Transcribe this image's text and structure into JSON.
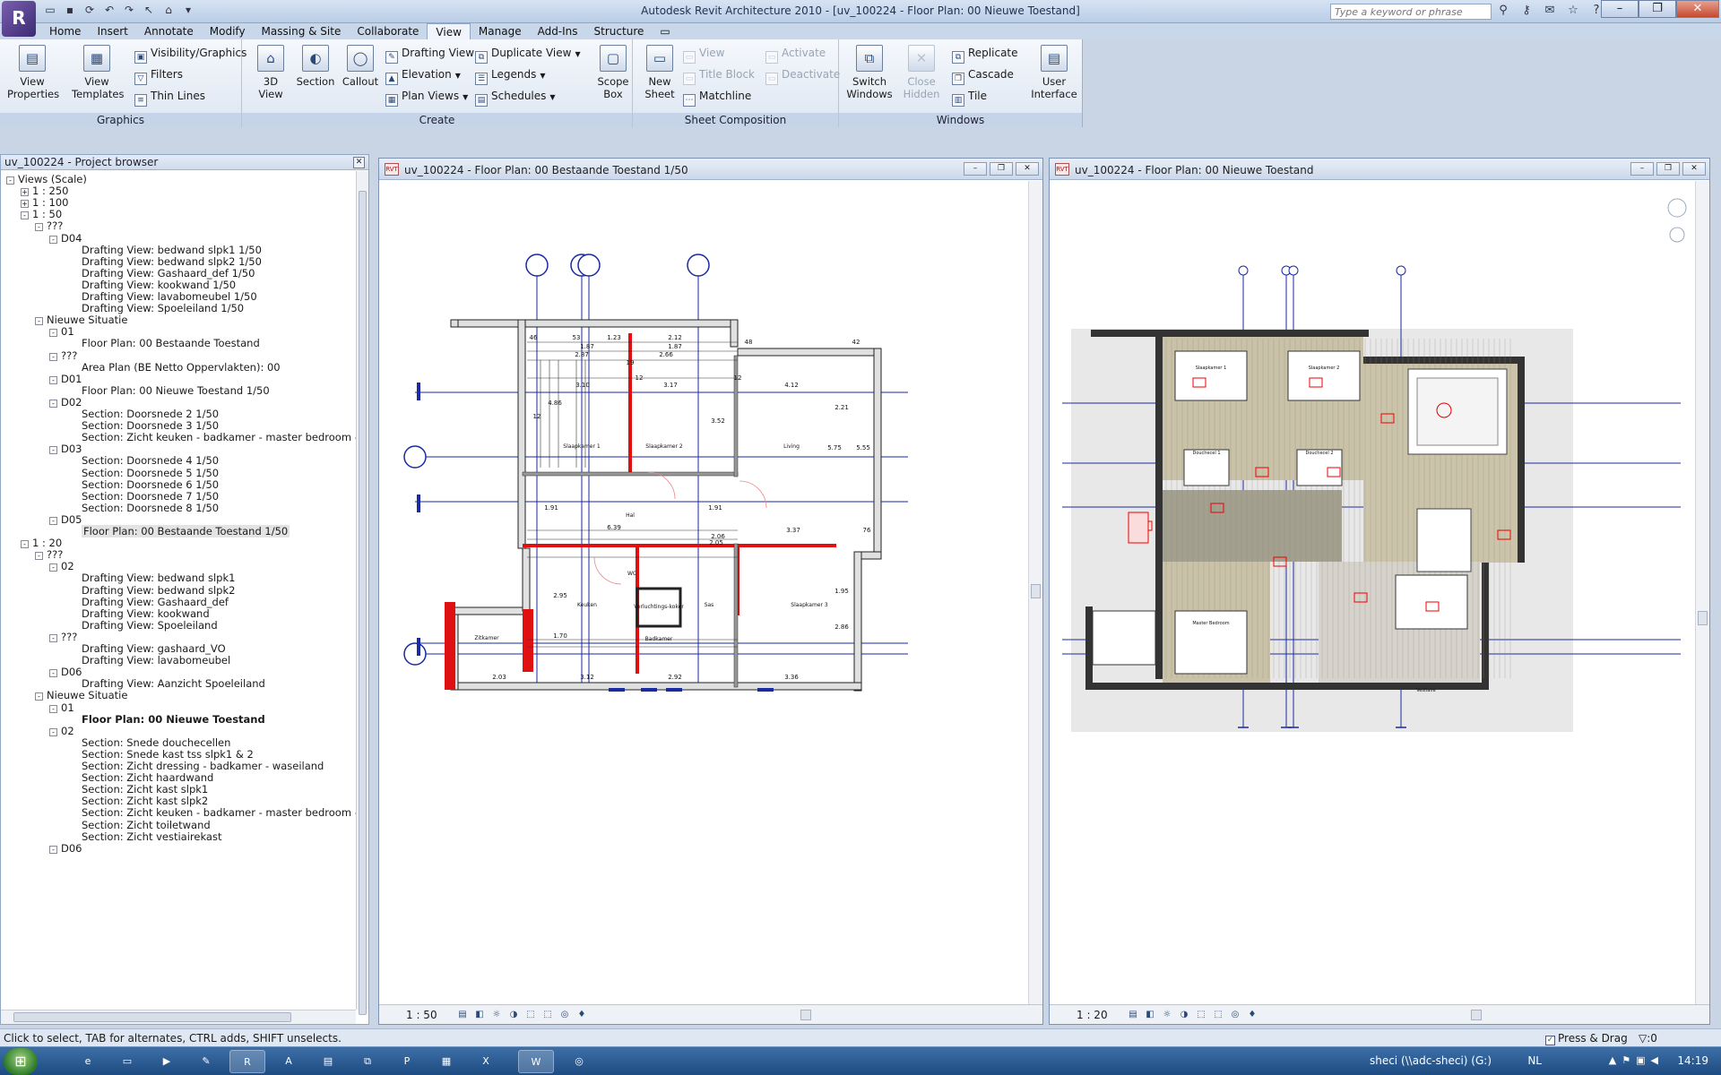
{
  "app": {
    "title": "Autodesk Revit Architecture 2010 - [uv_100224 - Floor Plan: 00 Nieuwe Toestand]",
    "logo_letter": "R",
    "search_placeholder": "Type a keyword or phrase"
  },
  "ribbon_tabs": [
    "Home",
    "Insert",
    "Annotate",
    "Modify",
    "Massing & Site",
    "Collaborate",
    "View",
    "Manage",
    "Add-Ins",
    "Structure"
  ],
  "active_tab": "View",
  "ribbon": {
    "graphics": {
      "label": "Graphics",
      "view_properties": "View\nProperties",
      "view_templates": "View\nTemplates",
      "visibility": "Visibility/Graphics",
      "filters": "Filters",
      "thin_lines": "Thin Lines"
    },
    "create": {
      "label": "Create",
      "view3d": "3D\nView",
      "section": "Section",
      "callout": "Callout",
      "drafting_view": "Drafting View",
      "elevation": "Elevation",
      "plan_views": "Plan Views",
      "duplicate_view": "Duplicate View",
      "legends": "Legends",
      "schedules": "Schedules",
      "scope_box": "Scope\nBox"
    },
    "sheet": {
      "label": "Sheet Composition",
      "new_sheet": "New\nSheet",
      "view": "View",
      "title_block": "Title Block",
      "matchline": "Matchline",
      "activate": "Activate",
      "deactivate": "Deactivate"
    },
    "windows": {
      "label": "Windows",
      "switch_windows": "Switch\nWindows",
      "close_hidden": "Close\nHidden",
      "replicate": "Replicate",
      "cascade": "Cascade",
      "tile": "Tile",
      "user_interface": "User\nInterface"
    }
  },
  "browser": {
    "title": "uv_100224 - Project browser",
    "items": [
      {
        "t": "Views (Scale)",
        "lvl": 0,
        "exp": "-"
      },
      {
        "t": "1 : 250",
        "lvl": 1,
        "exp": "+"
      },
      {
        "t": "1 : 100",
        "lvl": 1,
        "exp": "+"
      },
      {
        "t": "1 : 50",
        "lvl": 1,
        "exp": "-"
      },
      {
        "t": "???",
        "lvl": 2,
        "exp": "-"
      },
      {
        "t": "D04",
        "lvl": 3,
        "exp": "-"
      },
      {
        "t": "Drafting View: bedwand slpk1 1/50",
        "lvl": 4
      },
      {
        "t": "Drafting View: bedwand slpk2 1/50",
        "lvl": 4
      },
      {
        "t": "Drafting View: Gashaard_def 1/50",
        "lvl": 4
      },
      {
        "t": "Drafting View: kookwand 1/50",
        "lvl": 4
      },
      {
        "t": "Drafting View: lavabomeubel 1/50",
        "lvl": 4
      },
      {
        "t": "Drafting View: Spoeleiland 1/50",
        "lvl": 4
      },
      {
        "t": "Nieuwe Situatie",
        "lvl": 2,
        "exp": "-"
      },
      {
        "t": "01",
        "lvl": 3,
        "exp": "-"
      },
      {
        "t": "Floor Plan: 00 Bestaande Toestand",
        "lvl": 4
      },
      {
        "t": "???",
        "lvl": 3,
        "exp": "-"
      },
      {
        "t": "Area Plan (BE Netto Oppervlakten): 00",
        "lvl": 4
      },
      {
        "t": "D01",
        "lvl": 3,
        "exp": "-"
      },
      {
        "t": "Floor Plan: 00 Nieuwe Toestand 1/50",
        "lvl": 4
      },
      {
        "t": "D02",
        "lvl": 3,
        "exp": "-"
      },
      {
        "t": "Section: Doorsnede 2 1/50",
        "lvl": 4
      },
      {
        "t": "Section: Doorsnede 3 1/50",
        "lvl": 4
      },
      {
        "t": "Section: Zicht keuken - badkamer - master bedroom - di",
        "lvl": 4
      },
      {
        "t": "D03",
        "lvl": 3,
        "exp": "-"
      },
      {
        "t": "Section: Doorsnede 4 1/50",
        "lvl": 4
      },
      {
        "t": "Section: Doorsnede 5 1/50",
        "lvl": 4
      },
      {
        "t": "Section: Doorsnede 6 1/50",
        "lvl": 4
      },
      {
        "t": "Section: Doorsnede 7 1/50",
        "lvl": 4
      },
      {
        "t": "Section: Doorsnede 8 1/50",
        "lvl": 4
      },
      {
        "t": "D05",
        "lvl": 3,
        "exp": "-"
      },
      {
        "t": "Floor Plan: 00 Bestaande Toestand 1/50",
        "lvl": 4,
        "selected": true
      },
      {
        "t": "1 : 20",
        "lvl": 1,
        "exp": "-"
      },
      {
        "t": "???",
        "lvl": 2,
        "exp": "-"
      },
      {
        "t": "02",
        "lvl": 3,
        "exp": "-"
      },
      {
        "t": "Drafting View: bedwand slpk1",
        "lvl": 4
      },
      {
        "t": "Drafting View: bedwand slpk2",
        "lvl": 4
      },
      {
        "t": "Drafting View: Gashaard_def",
        "lvl": 4
      },
      {
        "t": "Drafting View: kookwand",
        "lvl": 4
      },
      {
        "t": "Drafting View: Spoeleiland",
        "lvl": 4
      },
      {
        "t": "???",
        "lvl": 3,
        "exp": "-"
      },
      {
        "t": "Drafting View: gashaard_VO",
        "lvl": 4
      },
      {
        "t": "Drafting View: lavabomeubel",
        "lvl": 4
      },
      {
        "t": "D06",
        "lvl": 3,
        "exp": "-"
      },
      {
        "t": "Drafting View: Aanzicht Spoeleiland",
        "lvl": 4
      },
      {
        "t": "Nieuwe Situatie",
        "lvl": 2,
        "exp": "-"
      },
      {
        "t": "01",
        "lvl": 3,
        "exp": "-"
      },
      {
        "t": "Floor Plan: 00 Nieuwe Toestand",
        "lvl": 4,
        "bold": true
      },
      {
        "t": "02",
        "lvl": 3,
        "exp": "-"
      },
      {
        "t": "Section: Snede douchecellen",
        "lvl": 4
      },
      {
        "t": "Section: Snede kast tss slpk1 & 2",
        "lvl": 4
      },
      {
        "t": "Section: Zicht dressing - badkamer - waseiland",
        "lvl": 4
      },
      {
        "t": "Section: Zicht haardwand",
        "lvl": 4
      },
      {
        "t": "Section: Zicht kast slpk1",
        "lvl": 4
      },
      {
        "t": "Section: Zicht kast slpk2",
        "lvl": 4
      },
      {
        "t": "Section: Zicht keuken - badkamer - master bedroom - di",
        "lvl": 4
      },
      {
        "t": "Section: Zicht toiletwand",
        "lvl": 4
      },
      {
        "t": "Section: Zicht vestiairekast",
        "lvl": 4
      },
      {
        "t": "D06",
        "lvl": 3,
        "exp": "-"
      }
    ]
  },
  "view_left": {
    "title": "uv_100224 - Floor Plan: 00 Bestaande Toestand 1/50",
    "scale": "1 : 50",
    "rooms": [
      "Slaapkamer 1",
      "Slaapkamer 2",
      "Living",
      "Hal",
      "WC",
      "Keuken",
      "Verluchtings-koker",
      "Sas",
      "Slaapkamer 3",
      "Badkamer",
      "Zitkamer"
    ],
    "dims": [
      "46",
      "53",
      "1.23",
      "2.12",
      "1.87",
      "1.87",
      "2.87",
      "2.66",
      "3.10",
      "3.17",
      "4.12",
      "2.21",
      "3.52",
      "4.86",
      "5.75",
      "5.55",
      "6.39",
      "3.37",
      "76",
      "1.91",
      "1.91",
      "2.06",
      "2.05",
      "3.12",
      "2.92",
      "3.36",
      "2.03",
      "1.70",
      "2.95",
      "1.95",
      "2.86",
      "48",
      "42",
      "12",
      "12",
      "12",
      "19"
    ]
  },
  "view_right": {
    "title": "uv_100224 - Floor Plan: 00 Nieuwe Toestand",
    "scale": "1 : 20",
    "rooms": [
      "Slaapkamer 1",
      "Slaapkamer 2",
      "Douchecel 1",
      "Douchecel 2",
      "Master Bedroom",
      "Vestiaire"
    ]
  },
  "status": {
    "text": "Click to select, TAB for alternates, CTRL adds, SHIFT unselects.",
    "press_drag": "Press & Drag",
    "filter_count": ":0"
  },
  "taskbar": {
    "drive": "sheci (\\\\adc-sheci) (G:)",
    "lang": "NL",
    "clock": "14:19"
  }
}
